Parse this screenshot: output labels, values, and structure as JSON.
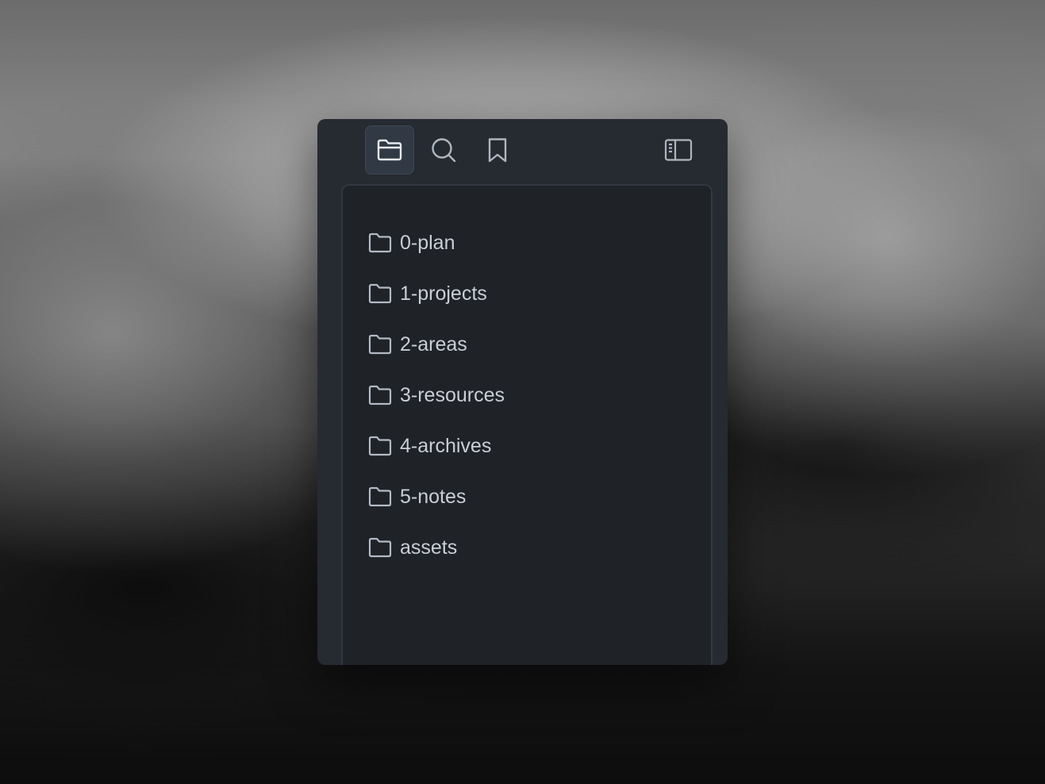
{
  "toolbar": {
    "buttons": [
      {
        "icon": "folder-open-icon",
        "active": true
      },
      {
        "icon": "search-icon",
        "active": false
      },
      {
        "icon": "bookmark-icon",
        "active": false
      },
      {
        "icon": "sidebar-toggle-icon",
        "active": false
      }
    ]
  },
  "file_tree": {
    "items": [
      {
        "label": "0-plan",
        "icon": "folder-icon"
      },
      {
        "label": "1-projects",
        "icon": "folder-icon"
      },
      {
        "label": "2-areas",
        "icon": "folder-icon"
      },
      {
        "label": "3-resources",
        "icon": "folder-icon"
      },
      {
        "label": "4-archives",
        "icon": "folder-icon"
      },
      {
        "label": "5-notes",
        "icon": "folder-icon"
      },
      {
        "label": "assets",
        "icon": "folder-icon"
      }
    ]
  },
  "colors": {
    "panel_bg": "#262a31",
    "tree_bg": "#1f2227",
    "active_tab_bg": "#313945",
    "text": "#c9ced6"
  }
}
